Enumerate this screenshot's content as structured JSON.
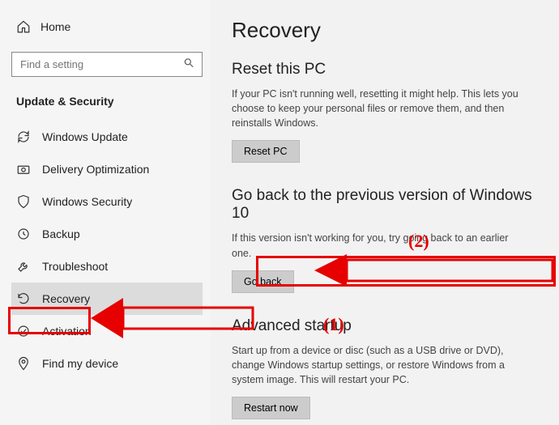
{
  "sidebar": {
    "home_label": "Home",
    "search_placeholder": "Find a setting",
    "section_label": "Update & Security",
    "items": [
      {
        "label": "Windows Update"
      },
      {
        "label": "Delivery Optimization"
      },
      {
        "label": "Windows Security"
      },
      {
        "label": "Backup"
      },
      {
        "label": "Troubleshoot"
      },
      {
        "label": "Recovery"
      },
      {
        "label": "Activation"
      },
      {
        "label": "Find my device"
      }
    ]
  },
  "content": {
    "page_title": "Recovery",
    "reset": {
      "heading": "Reset this PC",
      "body": "If your PC isn't running well, resetting it might help. This lets you choose to keep your personal files or remove them, and then reinstalls Windows.",
      "button": "Reset PC"
    },
    "goback": {
      "heading": "Go back to the previous version of Windows 10",
      "body": "If this version isn't working for you, try going back to an earlier one.",
      "button": "Go back"
    },
    "advanced": {
      "heading": "Advanced startup",
      "body": "Start up from a device or disc (such as a USB drive or DVD), change Windows startup settings, or restore Windows from a system image. This will restart your PC.",
      "button": "Restart now"
    }
  },
  "annotations": {
    "label1": "(1)",
    "label2": "(2)"
  }
}
